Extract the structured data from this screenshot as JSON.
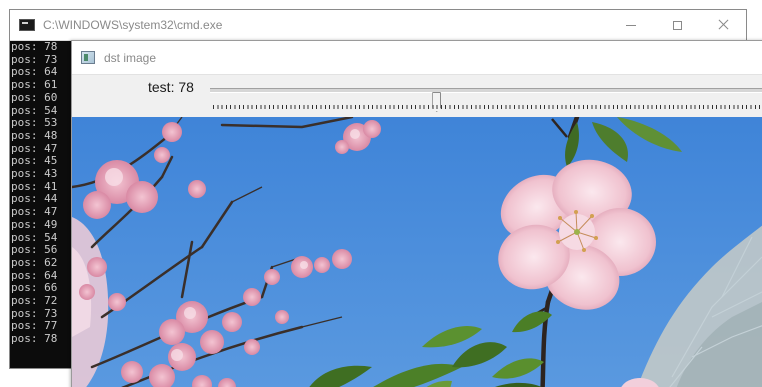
{
  "cmd": {
    "title": "C:\\WINDOWS\\system32\\cmd.exe",
    "lines": [
      "pos: 78",
      "pos: 73",
      "pos: 64",
      "pos: 61",
      "pos: 60",
      "pos: 54",
      "pos: 53",
      "pos: 48",
      "pos: 47",
      "pos: 45",
      "pos: 43",
      "pos: 41",
      "pos: 44",
      "pos: 47",
      "pos: 49",
      "pos: 54",
      "pos: 56",
      "pos: 62",
      "pos: 64",
      "pos: 66",
      "pos: 72",
      "pos: 73",
      "pos: 77",
      "pos: 78"
    ]
  },
  "dst": {
    "title": "dst image",
    "trackbar": {
      "label": "test: 78",
      "position_fraction": 0.404
    }
  },
  "colors": {
    "sky": "#4f8fdc",
    "blossom": "#f1c6d2",
    "leaf": "#4f7d2e"
  }
}
